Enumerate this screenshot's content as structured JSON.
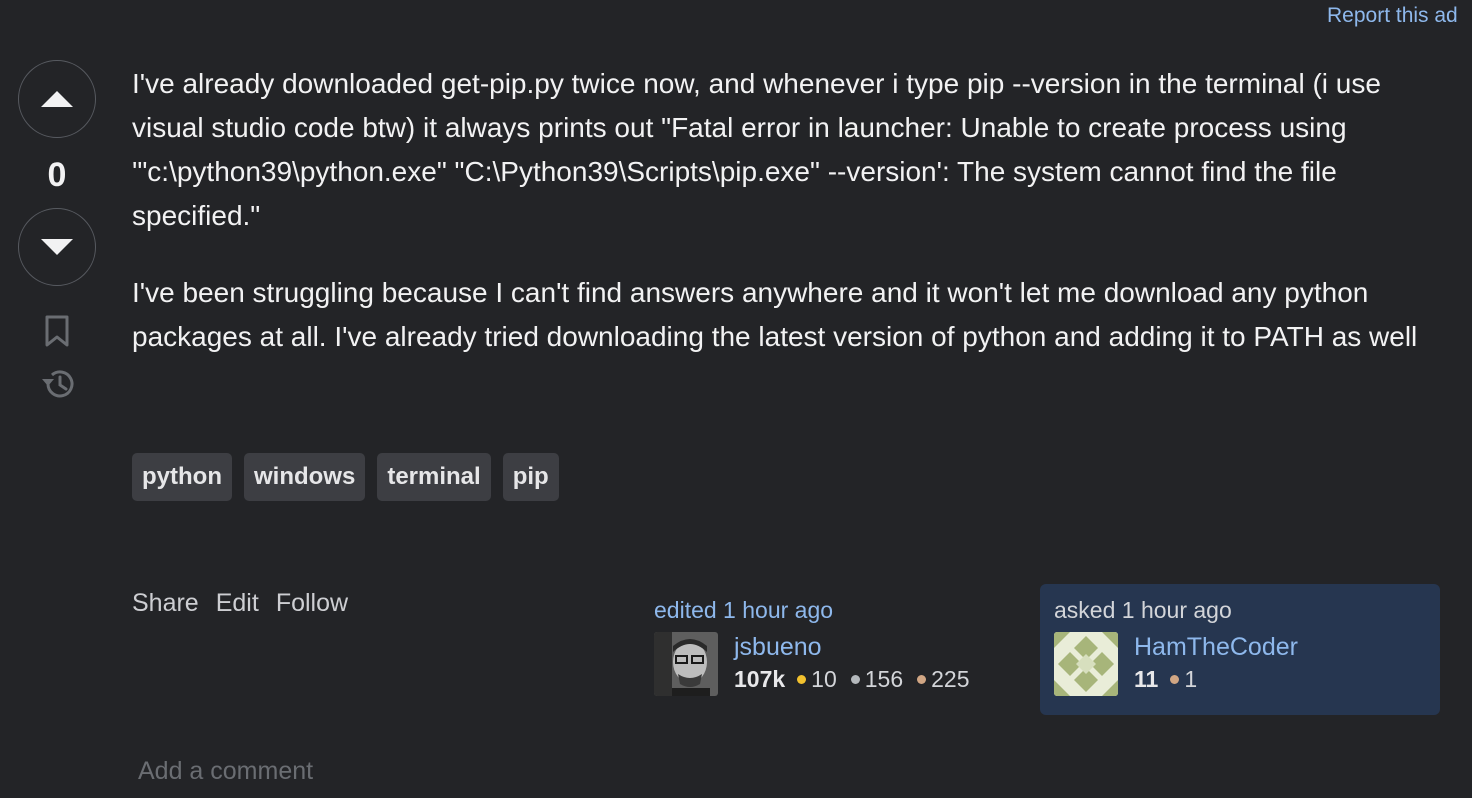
{
  "ad": {
    "report_label": "Report this ad"
  },
  "vote": {
    "score": "0"
  },
  "post": {
    "paragraphs": [
      "I've already downloaded get-pip.py twice now, and whenever i type pip --version in the terminal (i use visual studio code btw) it always prints out \"Fatal error in launcher: Unable to create process using '\"c:\\python39\\python.exe\" \"C:\\Python39\\Scripts\\pip.exe\" --version': The system cannot find the file specified.\"",
      "I've been struggling because I can't find answers anywhere and it won't let me download any python packages at all. I've already tried downloading the latest version of python and adding it to PATH as well"
    ],
    "tags": [
      "python",
      "windows",
      "terminal",
      "pip"
    ]
  },
  "actions": {
    "share": "Share",
    "edit": "Edit",
    "follow": "Follow"
  },
  "editor": {
    "time": "edited 1 hour ago",
    "name": "jsbueno",
    "reputation": "107k",
    "gold": "10",
    "silver": "156",
    "bronze": "225"
  },
  "owner": {
    "time": "asked 1 hour ago",
    "name": "HamTheCoder",
    "reputation": "11",
    "bronze": "1"
  },
  "comment": {
    "add_label": "Add a comment"
  },
  "icons": {
    "upvote": "arrow-up-icon",
    "downvote": "arrow-down-icon",
    "bookmark": "bookmark-icon",
    "history": "history-icon"
  },
  "colors": {
    "background": "#232427",
    "link": "#8eb8ec",
    "tag_bg": "#3d3e43",
    "owner_card_bg": "#263650",
    "gold": "#f2c12e",
    "silver": "#b4b8bc",
    "bronze": "#d1a684"
  }
}
